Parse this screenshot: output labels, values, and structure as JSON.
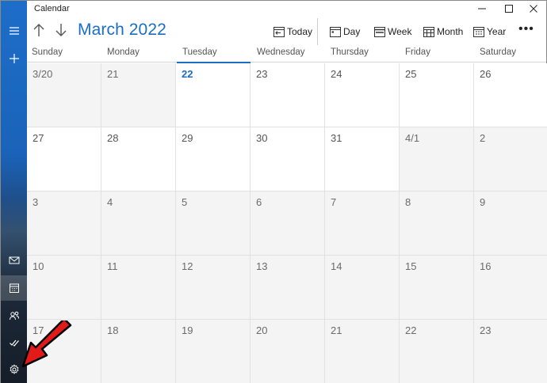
{
  "app": {
    "title": "Calendar"
  },
  "header": {
    "month_title": "March 2022",
    "buttons": {
      "today": "Today",
      "day": "Day",
      "week": "Week",
      "month": "Month",
      "year": "Year"
    }
  },
  "weekdays": [
    "Sunday",
    "Monday",
    "Tuesday",
    "Wednesday",
    "Thursday",
    "Friday",
    "Saturday"
  ],
  "weeks": [
    [
      "3/20",
      "21",
      "22",
      "23",
      "24",
      "25",
      "26"
    ],
    [
      "27",
      "28",
      "29",
      "30",
      "31",
      "4/1",
      "2"
    ],
    [
      "3",
      "4",
      "5",
      "6",
      "7",
      "8",
      "9"
    ],
    [
      "10",
      "11",
      "12",
      "13",
      "14",
      "15",
      "16"
    ],
    [
      "17",
      "18",
      "19",
      "20",
      "21",
      "22",
      "23"
    ]
  ],
  "today_label": "22",
  "colors": {
    "accent": "#1a6fc4",
    "rail_top": "#1d6ec9",
    "annotation_arrow": "#e21a1a"
  },
  "icons": {
    "rail": [
      "menu-icon",
      "add-event-icon",
      "mail-icon",
      "calendar-icon",
      "people-icon",
      "todo-icon",
      "settings-icon"
    ],
    "header": [
      "arrow-up-icon",
      "arrow-down-icon",
      "today-icon",
      "day-icon",
      "week-icon",
      "month-icon",
      "year-icon",
      "more-icon"
    ]
  }
}
